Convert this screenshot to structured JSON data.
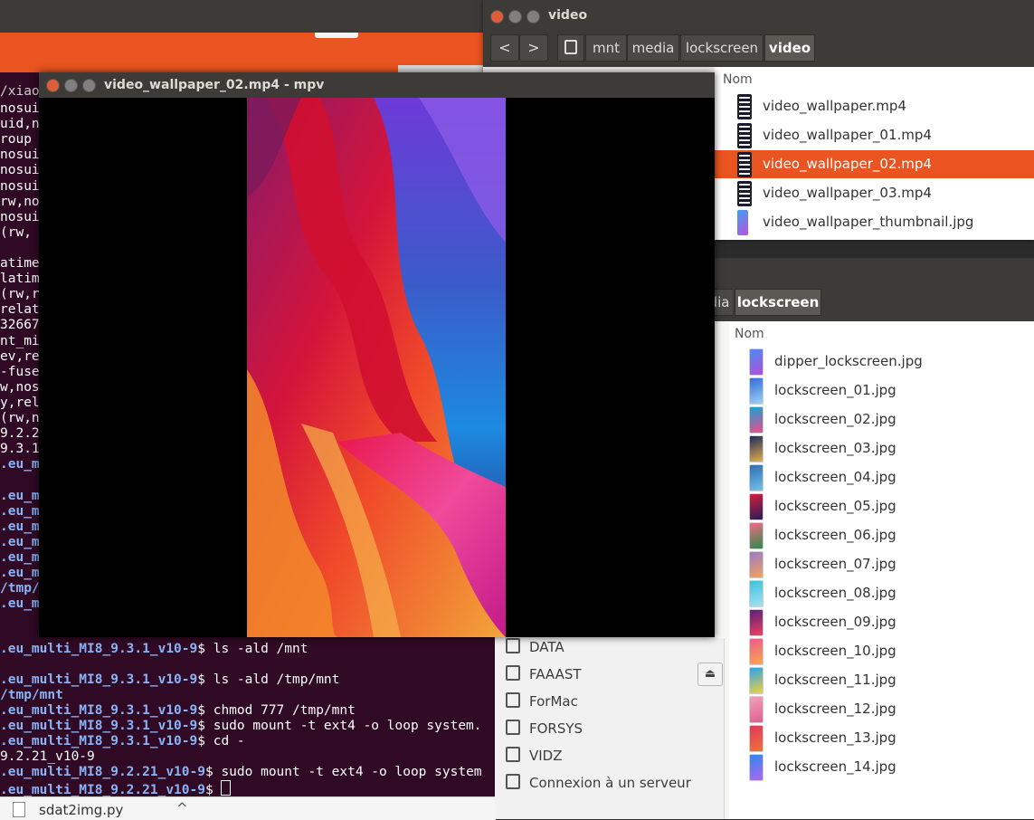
{
  "terminal": {
    "title_fragment": "/xiaom",
    "lines_fragments": [
      "nosuid",
      "uid,no",
      "roup",
      "nosuid",
      "nosuid",
      "nosuid",
      "rw,nos",
      "nosuid",
      "(rw,",
      "",
      "atime",
      "latime",
      "(rw,re",
      "relat",
      "32667",
      "nt_mis",
      "ev,re",
      "-fuse",
      "w,nosu",
      "y,rela",
      "(rw,no",
      "9.2.2",
      "9.3.1_",
      ".eu_mu",
      "",
      ".eu_mu",
      ".eu_mu",
      ".eu_mu",
      ".eu_mu",
      ".eu_mu",
      ".eu_mu",
      "/tmp/",
      ".eu_mu"
    ],
    "commands": [
      {
        "prompt": ".eu_multi_MI8_9.3.1_v10-9",
        "cmd": "$ ls -ald /mnt"
      },
      {
        "prompt": "",
        "cmd": ""
      },
      {
        "prompt": ".eu_multi_MI8_9.3.1_v10-9",
        "cmd": "$ ls -ald /tmp/mnt"
      },
      {
        "prompt": "/tmp/mnt",
        "cmd": ""
      },
      {
        "prompt": ".eu_multi_MI8_9.3.1_v10-9",
        "cmd": "$ chmod 777 /tmp/mnt"
      },
      {
        "prompt": ".eu_multi_MI8_9.3.1_v10-9",
        "cmd": "$ sudo mount -t ext4 -o loop system."
      },
      {
        "prompt": ".eu_multi_MI8_9.3.1_v10-9",
        "cmd": "$ cd -"
      },
      {
        "prompt": "",
        "cmd": "9.2.21_v10-9"
      },
      {
        "prompt": ".eu_multi_MI8_9.2.21_v10-9",
        "cmd": "$ sudo mount -t ext4 -o loop system"
      },
      {
        "prompt": ".eu_multi_MI8_9.2.21_v10-9",
        "cmd": "$ "
      }
    ]
  },
  "download_bar": {
    "filename": "sdat2img.py",
    "chevron": "^"
  },
  "video_window": {
    "title": "video",
    "nav_back": "<",
    "nav_forward": ">",
    "breadcrumb": [
      "mnt",
      "media",
      "lockscreen",
      "video"
    ],
    "column_header": "Nom",
    "files": [
      {
        "name": "video_wallpaper.mp4",
        "type": "video"
      },
      {
        "name": "video_wallpaper_01.mp4",
        "type": "video"
      },
      {
        "name": "video_wallpaper_02.mp4",
        "type": "video",
        "selected": true
      },
      {
        "name": "video_wallpaper_03.mp4",
        "type": "video"
      },
      {
        "name": "video_wallpaper_thumbnail.jpg",
        "type": "image"
      }
    ]
  },
  "lock_window": {
    "breadcrumb": [
      "dia",
      "lockscreen"
    ],
    "column_header": "Nom",
    "sidebar": [
      {
        "label": "DATA"
      },
      {
        "label": "FAAAST"
      },
      {
        "label": "ForMac"
      },
      {
        "label": "FORSYS"
      },
      {
        "label": "VIDZ"
      },
      {
        "label": "Connexion à un serveur"
      }
    ],
    "eject_icon": "⏏",
    "files": [
      {
        "name": "dipper_lockscreen.jpg",
        "colors": [
          "#4a8cf0",
          "#b34fd8"
        ]
      },
      {
        "name": "lockscreen_01.jpg",
        "colors": [
          "#2f6fd6",
          "#9fd0f5"
        ]
      },
      {
        "name": "lockscreen_02.jpg",
        "colors": [
          "#13a3d6",
          "#f04b8a"
        ]
      },
      {
        "name": "lockscreen_03.jpg",
        "colors": [
          "#1d2a5e",
          "#e2b04a"
        ]
      },
      {
        "name": "lockscreen_04.jpg",
        "colors": [
          "#2b6fb5",
          "#77c0e8"
        ]
      },
      {
        "name": "lockscreen_05.jpg",
        "colors": [
          "#d41e3b",
          "#2a1b5a"
        ]
      },
      {
        "name": "lockscreen_06.jpg",
        "colors": [
          "#f06a80",
          "#2d8a4e"
        ]
      },
      {
        "name": "lockscreen_07.jpg",
        "colors": [
          "#9a7ac9",
          "#f1a25d"
        ]
      },
      {
        "name": "lockscreen_08.jpg",
        "colors": [
          "#3cc0e0",
          "#a5e2ef"
        ]
      },
      {
        "name": "lockscreen_09.jpg",
        "colors": [
          "#5a1f7a",
          "#f04060"
        ]
      },
      {
        "name": "lockscreen_10.jpg",
        "colors": [
          "#f05a8a",
          "#f5a94a"
        ]
      },
      {
        "name": "lockscreen_11.jpg",
        "colors": [
          "#29a3f0",
          "#f0d23a"
        ]
      },
      {
        "name": "lockscreen_12.jpg",
        "colors": [
          "#f2a0b8",
          "#e06090"
        ]
      },
      {
        "name": "lockscreen_13.jpg",
        "colors": [
          "#e03a5a",
          "#f0703a"
        ]
      },
      {
        "name": "lockscreen_14.jpg",
        "colors": [
          "#2a8af0",
          "#b065f0"
        ]
      }
    ]
  },
  "mpv_window": {
    "title": "video_wallpaper_02.mp4 - mpv"
  },
  "colors": {
    "accent": "#e95420",
    "titlebar": "#3c3b37",
    "terminal_bg": "#300a24"
  }
}
